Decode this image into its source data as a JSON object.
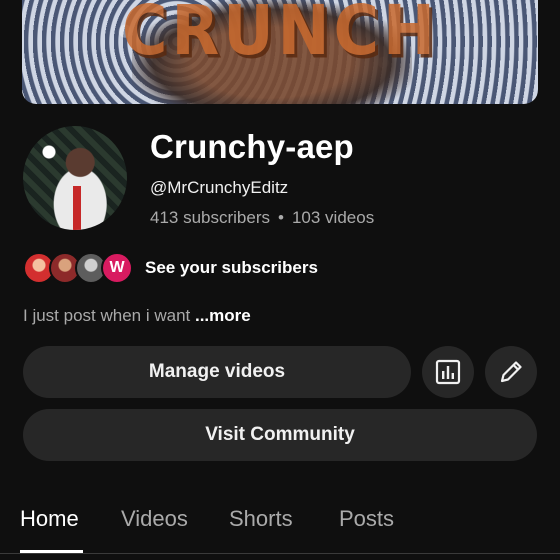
{
  "banner": {
    "text": "CRUNCH"
  },
  "channel": {
    "name": "Crunchy-aep",
    "handle": "@MrCrunchyEditz",
    "subscribers": "413 subscribers",
    "separator": "•",
    "videos": "103 videos"
  },
  "subscribers_preview": {
    "last_avatar_letter": "W",
    "label": "See your subscribers"
  },
  "description": {
    "text": "I just post when i want ",
    "more": "...more"
  },
  "actions": {
    "manage_label": "Manage videos",
    "analytics_icon": "analytics-icon",
    "edit_icon": "pencil-icon",
    "community_label": "Visit Community"
  },
  "tabs": [
    {
      "label": "Home",
      "active": true
    },
    {
      "label": "Videos",
      "active": false
    },
    {
      "label": "Shorts",
      "active": false
    },
    {
      "label": "Posts",
      "active": false
    }
  ],
  "colors": {
    "background": "#0f0f0f",
    "button": "#272727",
    "accent_avatar": "#d81b60"
  }
}
